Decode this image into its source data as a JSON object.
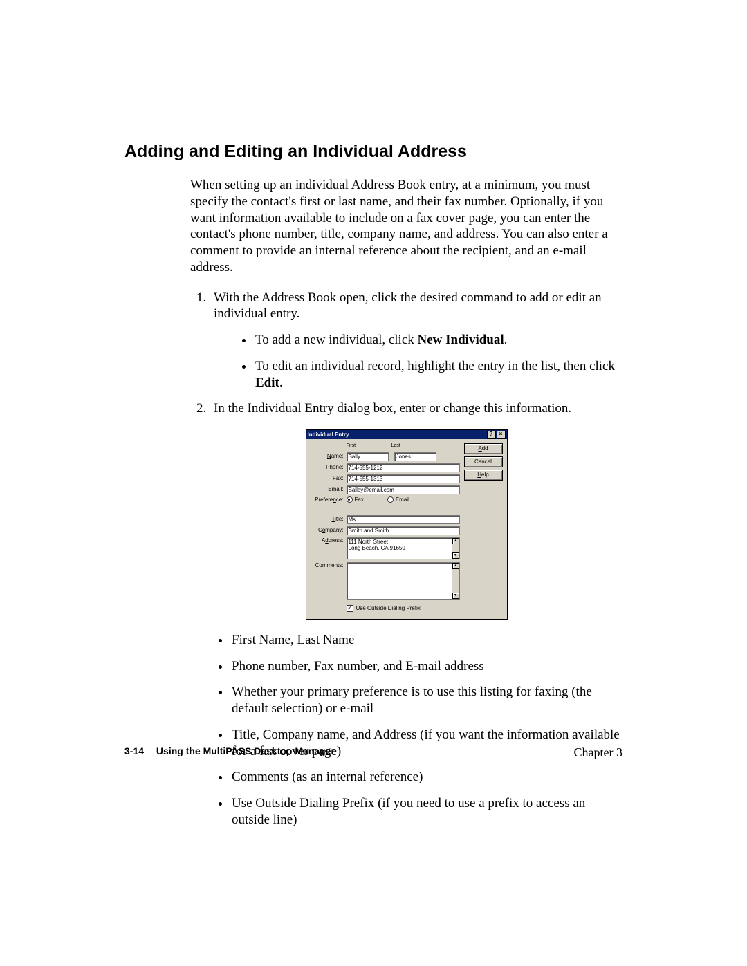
{
  "heading": "Adding and Editing an Individual Address",
  "intro": "When setting up an individual Address Book entry, at a minimum, you must specify the contact's first or last name, and their fax number. Optionally, if you want information available to include on a fax cover page, you can enter the contact's phone number, title, company name, and address. You can also enter a comment to provide an internal reference about the recipient, and an e-mail address.",
  "step1": "With the Address Book open, click the desired command to add or edit an individual entry.",
  "step1_b1_pre": "To add a new individual, click ",
  "step1_b1_bold": "New Individual",
  "step1_b1_post": ".",
  "step1_b2_pre": "To edit an individual record, highlight the entry in the list, then click ",
  "step1_b2_bold": "Edit",
  "step1_b2_post": ".",
  "step2": "In the Individual Entry dialog box, enter or change this information.",
  "after_bullets": {
    "b1": "First Name, Last Name",
    "b2": "Phone number, Fax number, and E-mail address",
    "b3": "Whether your primary preference is to use this listing for faxing (the default selection) or e-mail",
    "b4": "Title, Company name, and Address (if you want the information available for a fax cover page)",
    "b5": "Comments (as an internal reference)",
    "b6": "Use Outside Dialing Prefix (if you need to use a prefix to access an outside line)"
  },
  "dialog": {
    "title": "Individual Entry",
    "help_glyph": "?",
    "close_glyph": "×",
    "buttons": {
      "add": "Add",
      "cancel": "Cancel",
      "help": "Help",
      "add_u": "A",
      "cancel_txt": "Cancel",
      "help_u": "H"
    },
    "labels": {
      "first": "First",
      "last": "Last",
      "name": "Name:",
      "phone": "Phone:",
      "fax": "Fax:",
      "email": "Email:",
      "preference": "Preference:",
      "fax_opt": "Fax",
      "email_opt": "Email",
      "title": "Title:",
      "company": "Company:",
      "address": "Address:",
      "comments": "Comments:",
      "use_prefix": "Use Outside Dialing Prefix"
    },
    "values": {
      "first": "Sally",
      "last": "Jones",
      "phone": "714-555-1212",
      "fax": "714-555-1313",
      "email": "Salley@email.com",
      "title": "Ms.",
      "company": "Smith and Smith",
      "address": "111 North Street\nLong Beach, CA 91650",
      "address_l1": "111 North Street",
      "address_l2": "Long Beach, CA 91650",
      "comments": "",
      "prefix_checked": "✓"
    }
  },
  "footer": {
    "page": "3-14",
    "title": "Using the MultiPASS Desktop Manager",
    "chapter": "Chapter 3"
  }
}
